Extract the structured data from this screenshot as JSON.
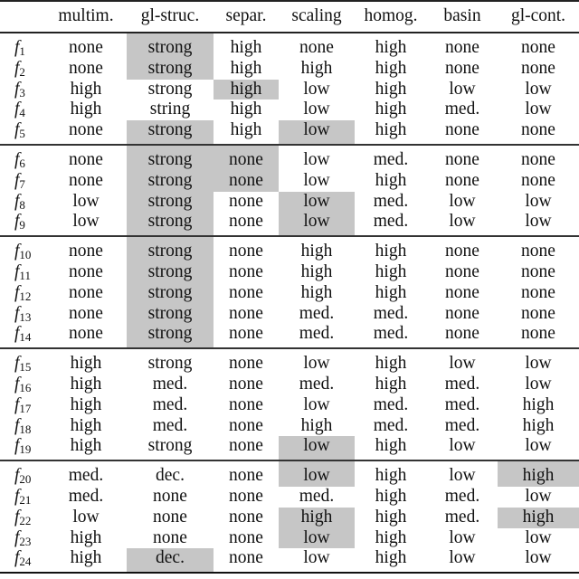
{
  "columns": [
    "",
    "multim.",
    "gl-struc.",
    "separ.",
    "scaling",
    "homog.",
    "basin",
    "gl-cont."
  ],
  "highlight_color": "#c6c6c6",
  "groups": [
    {
      "rows": [
        {
          "fn": "f",
          "idx": "1",
          "cells": [
            "none",
            "strong",
            "high",
            "none",
            "high",
            "none",
            "none"
          ],
          "hl": [
            false,
            true,
            false,
            false,
            false,
            false,
            false
          ]
        },
        {
          "fn": "f",
          "idx": "2",
          "cells": [
            "none",
            "strong",
            "high",
            "high",
            "high",
            "none",
            "none"
          ],
          "hl": [
            false,
            true,
            false,
            false,
            false,
            false,
            false
          ]
        },
        {
          "fn": "f",
          "idx": "3",
          "cells": [
            "high",
            "strong",
            "high",
            "low",
            "high",
            "low",
            "low"
          ],
          "hl": [
            false,
            false,
            true,
            false,
            false,
            false,
            false
          ]
        },
        {
          "fn": "f",
          "idx": "4",
          "cells": [
            "high",
            "string",
            "high",
            "low",
            "high",
            "med.",
            "low"
          ],
          "hl": [
            false,
            false,
            false,
            false,
            false,
            false,
            false
          ]
        },
        {
          "fn": "f",
          "idx": "5",
          "cells": [
            "none",
            "strong",
            "high",
            "low",
            "high",
            "none",
            "none"
          ],
          "hl": [
            false,
            true,
            false,
            true,
            false,
            false,
            false
          ]
        }
      ]
    },
    {
      "rows": [
        {
          "fn": "f",
          "idx": "6",
          "cells": [
            "none",
            "strong",
            "none",
            "low",
            "med.",
            "none",
            "none"
          ],
          "hl": [
            false,
            true,
            true,
            false,
            false,
            false,
            false
          ]
        },
        {
          "fn": "f",
          "idx": "7",
          "cells": [
            "none",
            "strong",
            "none",
            "low",
            "high",
            "none",
            "none"
          ],
          "hl": [
            false,
            true,
            true,
            false,
            false,
            false,
            false
          ]
        },
        {
          "fn": "f",
          "idx": "8",
          "cells": [
            "low",
            "strong",
            "none",
            "low",
            "med.",
            "low",
            "low"
          ],
          "hl": [
            false,
            true,
            false,
            true,
            false,
            false,
            false
          ]
        },
        {
          "fn": "f",
          "idx": "9",
          "cells": [
            "low",
            "strong",
            "none",
            "low",
            "med.",
            "low",
            "low"
          ],
          "hl": [
            false,
            true,
            false,
            true,
            false,
            false,
            false
          ]
        }
      ]
    },
    {
      "rows": [
        {
          "fn": "f",
          "idx": "10",
          "cells": [
            "none",
            "strong",
            "none",
            "high",
            "high",
            "none",
            "none"
          ],
          "hl": [
            false,
            true,
            false,
            false,
            false,
            false,
            false
          ]
        },
        {
          "fn": "f",
          "idx": "11",
          "cells": [
            "none",
            "strong",
            "none",
            "high",
            "high",
            "none",
            "none"
          ],
          "hl": [
            false,
            true,
            false,
            false,
            false,
            false,
            false
          ]
        },
        {
          "fn": "f",
          "idx": "12",
          "cells": [
            "none",
            "strong",
            "none",
            "high",
            "high",
            "none",
            "none"
          ],
          "hl": [
            false,
            true,
            false,
            false,
            false,
            false,
            false
          ]
        },
        {
          "fn": "f",
          "idx": "13",
          "cells": [
            "none",
            "strong",
            "none",
            "med.",
            "med.",
            "none",
            "none"
          ],
          "hl": [
            false,
            true,
            false,
            false,
            false,
            false,
            false
          ]
        },
        {
          "fn": "f",
          "idx": "14",
          "cells": [
            "none",
            "strong",
            "none",
            "med.",
            "med.",
            "none",
            "none"
          ],
          "hl": [
            false,
            true,
            false,
            false,
            false,
            false,
            false
          ]
        }
      ]
    },
    {
      "rows": [
        {
          "fn": "f",
          "idx": "15",
          "cells": [
            "high",
            "strong",
            "none",
            "low",
            "high",
            "low",
            "low"
          ],
          "hl": [
            false,
            false,
            false,
            false,
            false,
            false,
            false
          ]
        },
        {
          "fn": "f",
          "idx": "16",
          "cells": [
            "high",
            "med.",
            "none",
            "med.",
            "high",
            "med.",
            "low"
          ],
          "hl": [
            false,
            false,
            false,
            false,
            false,
            false,
            false
          ]
        },
        {
          "fn": "f",
          "idx": "17",
          "cells": [
            "high",
            "med.",
            "none",
            "low",
            "med.",
            "med.",
            "high"
          ],
          "hl": [
            false,
            false,
            false,
            false,
            false,
            false,
            false
          ]
        },
        {
          "fn": "f",
          "idx": "18",
          "cells": [
            "high",
            "med.",
            "none",
            "high",
            "med.",
            "med.",
            "high"
          ],
          "hl": [
            false,
            false,
            false,
            false,
            false,
            false,
            false
          ]
        },
        {
          "fn": "f",
          "idx": "19",
          "cells": [
            "high",
            "strong",
            "none",
            "low",
            "high",
            "low",
            "low"
          ],
          "hl": [
            false,
            false,
            false,
            true,
            false,
            false,
            false
          ]
        }
      ]
    },
    {
      "rows": [
        {
          "fn": "f",
          "idx": "20",
          "cells": [
            "med.",
            "dec.",
            "none",
            "low",
            "high",
            "low",
            "high"
          ],
          "hl": [
            false,
            false,
            false,
            true,
            false,
            false,
            true
          ]
        },
        {
          "fn": "f",
          "idx": "21",
          "cells": [
            "med.",
            "none",
            "none",
            "med.",
            "high",
            "med.",
            "low"
          ],
          "hl": [
            false,
            false,
            false,
            false,
            false,
            false,
            false
          ]
        },
        {
          "fn": "f",
          "idx": "22",
          "cells": [
            "low",
            "none",
            "none",
            "high",
            "high",
            "med.",
            "high"
          ],
          "hl": [
            false,
            false,
            false,
            true,
            false,
            false,
            true
          ]
        },
        {
          "fn": "f",
          "idx": "23",
          "cells": [
            "high",
            "none",
            "none",
            "low",
            "high",
            "low",
            "low"
          ],
          "hl": [
            false,
            false,
            false,
            true,
            false,
            false,
            false
          ]
        },
        {
          "fn": "f",
          "idx": "24",
          "cells": [
            "high",
            "dec.",
            "none",
            "low",
            "high",
            "low",
            "low"
          ],
          "hl": [
            false,
            true,
            false,
            false,
            false,
            false,
            false
          ]
        }
      ]
    }
  ]
}
